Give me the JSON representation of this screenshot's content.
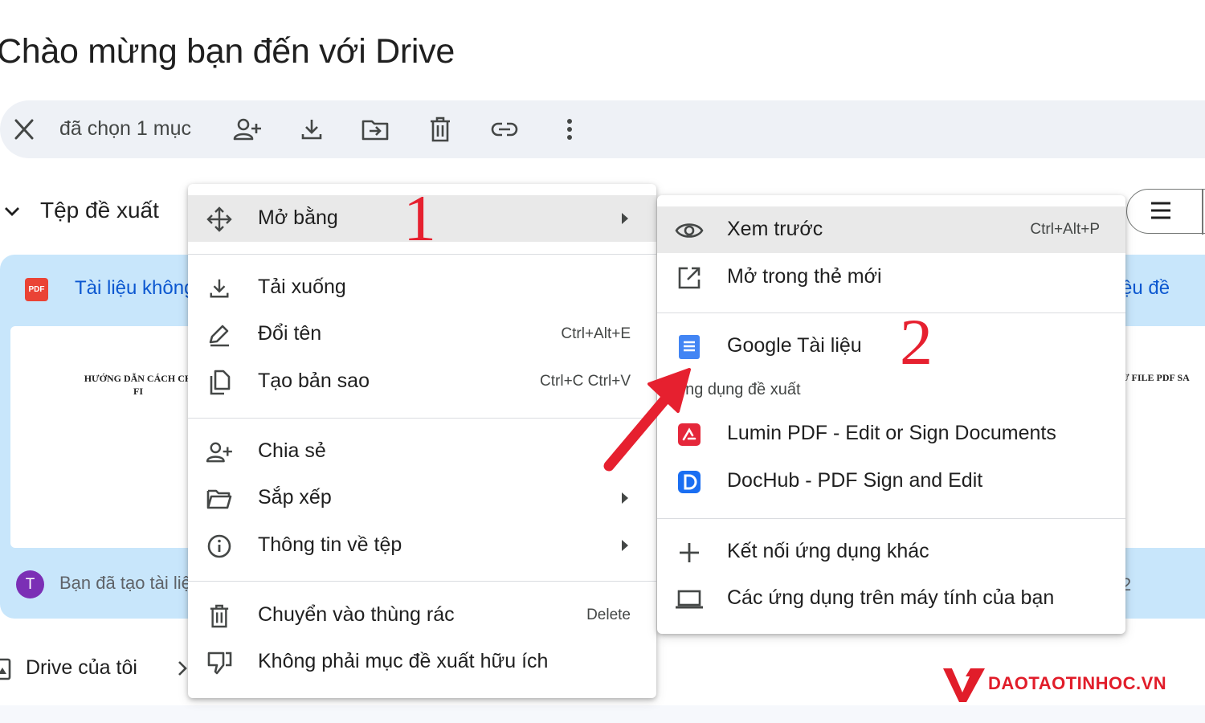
{
  "page": {
    "title": "Chào mừng bạn đến với Drive"
  },
  "selection_bar": {
    "selected_text": "đã chọn 1 mục"
  },
  "section": {
    "title": "Tệp đề xuất"
  },
  "card": {
    "badge": "PDF",
    "name": "Tài liệu không",
    "thumb_line1": "HƯỚNG DẪN CÁCH CH",
    "thumb_line2": "FI",
    "avatar_letter": "T",
    "footer": "Bạn đã tạo tài liệu"
  },
  "right_card": {
    "name": "ệu đề",
    "thumb_text": "Ừ FILE PDF SA",
    "footer": "2"
  },
  "bottom": {
    "drive_label": "Drive của tôi"
  },
  "menu_primary": {
    "open_with": "Mở bằng",
    "download": "Tải xuống",
    "rename": {
      "label": "Đổi tên",
      "shortcut": "Ctrl+Alt+E"
    },
    "copy": {
      "label": "Tạo bản sao",
      "shortcut": "Ctrl+C Ctrl+V"
    },
    "share": "Chia sẻ",
    "organize": "Sắp xếp",
    "file_info": "Thông tin về tệp",
    "trash": {
      "label": "Chuyển vào thùng rác",
      "shortcut": "Delete"
    },
    "not_helpful": "Không phải mục đề xuất hữu ích"
  },
  "menu_open_with": {
    "preview": {
      "label": "Xem trước",
      "shortcut": "Ctrl+Alt+P"
    },
    "new_tab": "Mở trong thẻ mới",
    "google_docs": "Google Tài liệu",
    "suggested_header": "Ứng dụng đề xuất",
    "lumin": "Lumin PDF - Edit or Sign Documents",
    "dochub": "DocHub - PDF Sign and Edit",
    "connect_more": "Kết nối ứng dụng khác",
    "computer_apps": "Các ứng dụng trên máy tính của bạn"
  },
  "annotations": {
    "step1": "1",
    "step2": "2",
    "accent": "#e6202f"
  },
  "watermark": {
    "text": "DAOTAOTINHOC.VN",
    "color": "#e11d2a"
  },
  "colors": {
    "selection_bar": "#eef1f6",
    "card": "#c8e6fb",
    "link": "#0b57d0",
    "highlight": "#e9e9e9"
  }
}
